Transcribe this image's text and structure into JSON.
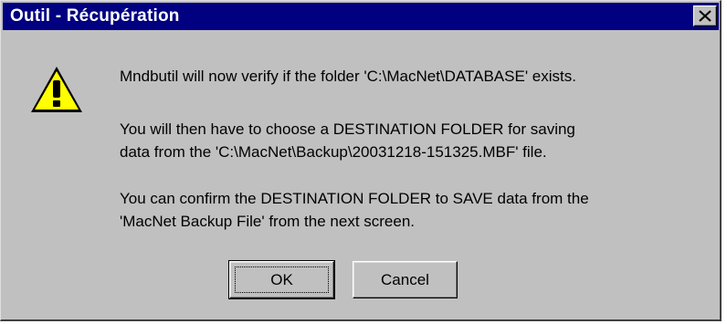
{
  "window": {
    "title": "Outil - Récupération",
    "title_bar_color": "#000080",
    "close_icon": "close-icon"
  },
  "message": {
    "icon": "warning-icon",
    "line1": "Mndbutil will now verify if the folder 'C:\\MacNet\\DATABASE' exists.",
    "para2_line1": "You will then have to choose a DESTINATION FOLDER for saving",
    "para2_line2": "data from the 'C:\\MacNet\\Backup\\20031218-151325.MBF' file.",
    "para3_line1": "You can confirm the DESTINATION FOLDER to SAVE data from the",
    "para3_line2": "'MacNet Backup File' from the next screen."
  },
  "buttons": {
    "ok_label": "OK",
    "cancel_label": "Cancel"
  }
}
